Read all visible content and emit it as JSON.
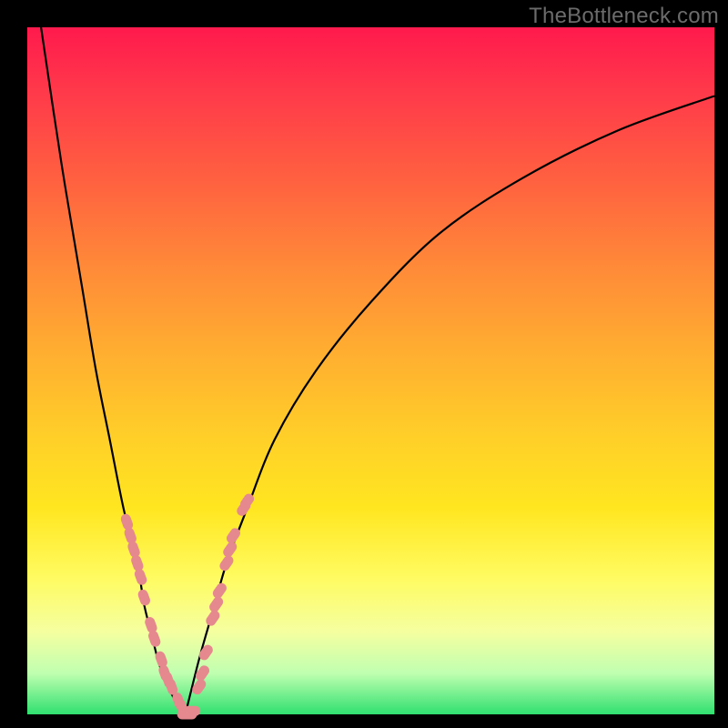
{
  "watermark": "TheBottleneck.com",
  "colors": {
    "frame": "#000000",
    "curve": "#000000",
    "marker": "#e6898e"
  },
  "chart_data": {
    "type": "line",
    "title": "",
    "xlabel": "",
    "ylabel": "",
    "xlim": [
      0,
      100
    ],
    "ylim": [
      0,
      100
    ],
    "grid": false,
    "series": [
      {
        "name": "left-curve",
        "x": [
          2,
          5,
          8,
          10,
          12,
          14,
          16,
          17,
          18,
          19,
          20,
          21,
          22,
          23
        ],
        "values": [
          100,
          80,
          62,
          50,
          40,
          30,
          22,
          16,
          12,
          8,
          5,
          3,
          1,
          0
        ]
      },
      {
        "name": "right-curve",
        "x": [
          23,
          25,
          27,
          29,
          32,
          36,
          42,
          50,
          60,
          72,
          86,
          100
        ],
        "values": [
          0,
          8,
          15,
          22,
          30,
          40,
          50,
          60,
          70,
          78,
          85,
          90
        ]
      }
    ],
    "markers": {
      "comment": "approximate (x, y) of highlighted data points along both curves",
      "points": [
        [
          14.5,
          28
        ],
        [
          15.0,
          26
        ],
        [
          15.5,
          24
        ],
        [
          16.0,
          22
        ],
        [
          16.5,
          20
        ],
        [
          17.0,
          17
        ],
        [
          18.0,
          13
        ],
        [
          18.5,
          11
        ],
        [
          19.5,
          8
        ],
        [
          20.0,
          6
        ],
        [
          20.5,
          5
        ],
        [
          21.0,
          4
        ],
        [
          22.0,
          2
        ],
        [
          22.5,
          1
        ],
        [
          23.0,
          0
        ],
        [
          23.5,
          0
        ],
        [
          24.0,
          0.5
        ],
        [
          25.0,
          4
        ],
        [
          25.5,
          6
        ],
        [
          26.0,
          9
        ],
        [
          27.0,
          14
        ],
        [
          27.5,
          16
        ],
        [
          28.0,
          18
        ],
        [
          29.0,
          22
        ],
        [
          29.5,
          24
        ],
        [
          30.0,
          26
        ],
        [
          31.5,
          30
        ],
        [
          32.0,
          31
        ]
      ]
    }
  }
}
